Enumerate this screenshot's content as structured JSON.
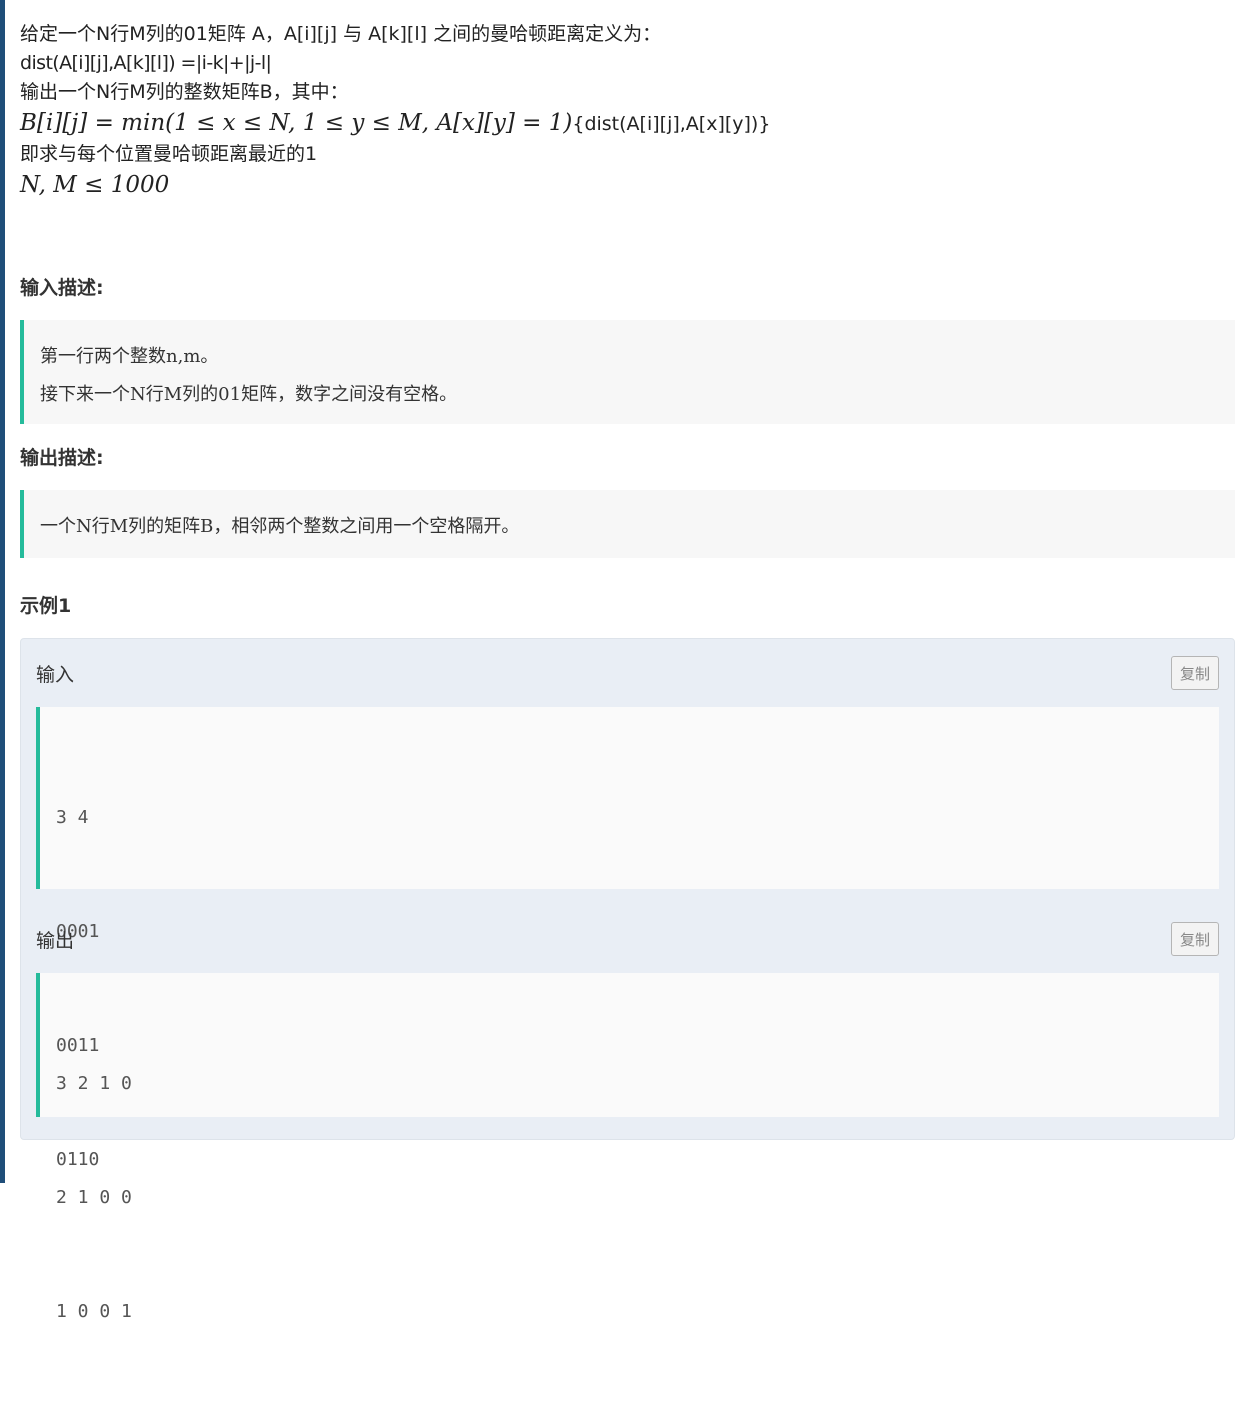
{
  "description": {
    "line1": "给定一个N行M列的01矩阵 A，A[i][j] 与 A[k][l] 之间的曼哈顿距离定义为：",
    "line2": "dist(A[i][j],A[k][l]) =|i-k|+|j-l|",
    "line3": "输出一个N行M列的整数矩阵B，其中：",
    "formula_math": "B[i][j] = min(1 ≤ x ≤ N, 1 ≤ y ≤ M, A[x][y] = 1)",
    "formula_text": "{dist(A[i][j],A[x][y])}",
    "line5": "即求与每个位置曼哈顿距离最近的1",
    "constraint": "N, M ≤ 1000"
  },
  "input_section": {
    "title": "输入描述:",
    "lines": [
      "第一行两个整数n,m。",
      "接下来一个N行M列的01矩阵，数字之间没有空格。"
    ]
  },
  "output_section": {
    "title": "输出描述:",
    "lines": [
      "一个N行M列的矩阵B，相邻两个整数之间用一个空格隔开。"
    ]
  },
  "example": {
    "title": "示例1",
    "input_label": "输入",
    "output_label": "输出",
    "copy_label": "复制",
    "input_lines": [
      "3 4",
      "0001",
      "0011",
      "0110"
    ],
    "output_lines": [
      "3 2 1 0",
      "2 1 0 0",
      "1 0 0 1"
    ]
  },
  "colors": {
    "accent_bar": "#25bb9b",
    "left_bar": "#1f4e79",
    "sample_bg": "#e9eef5"
  }
}
